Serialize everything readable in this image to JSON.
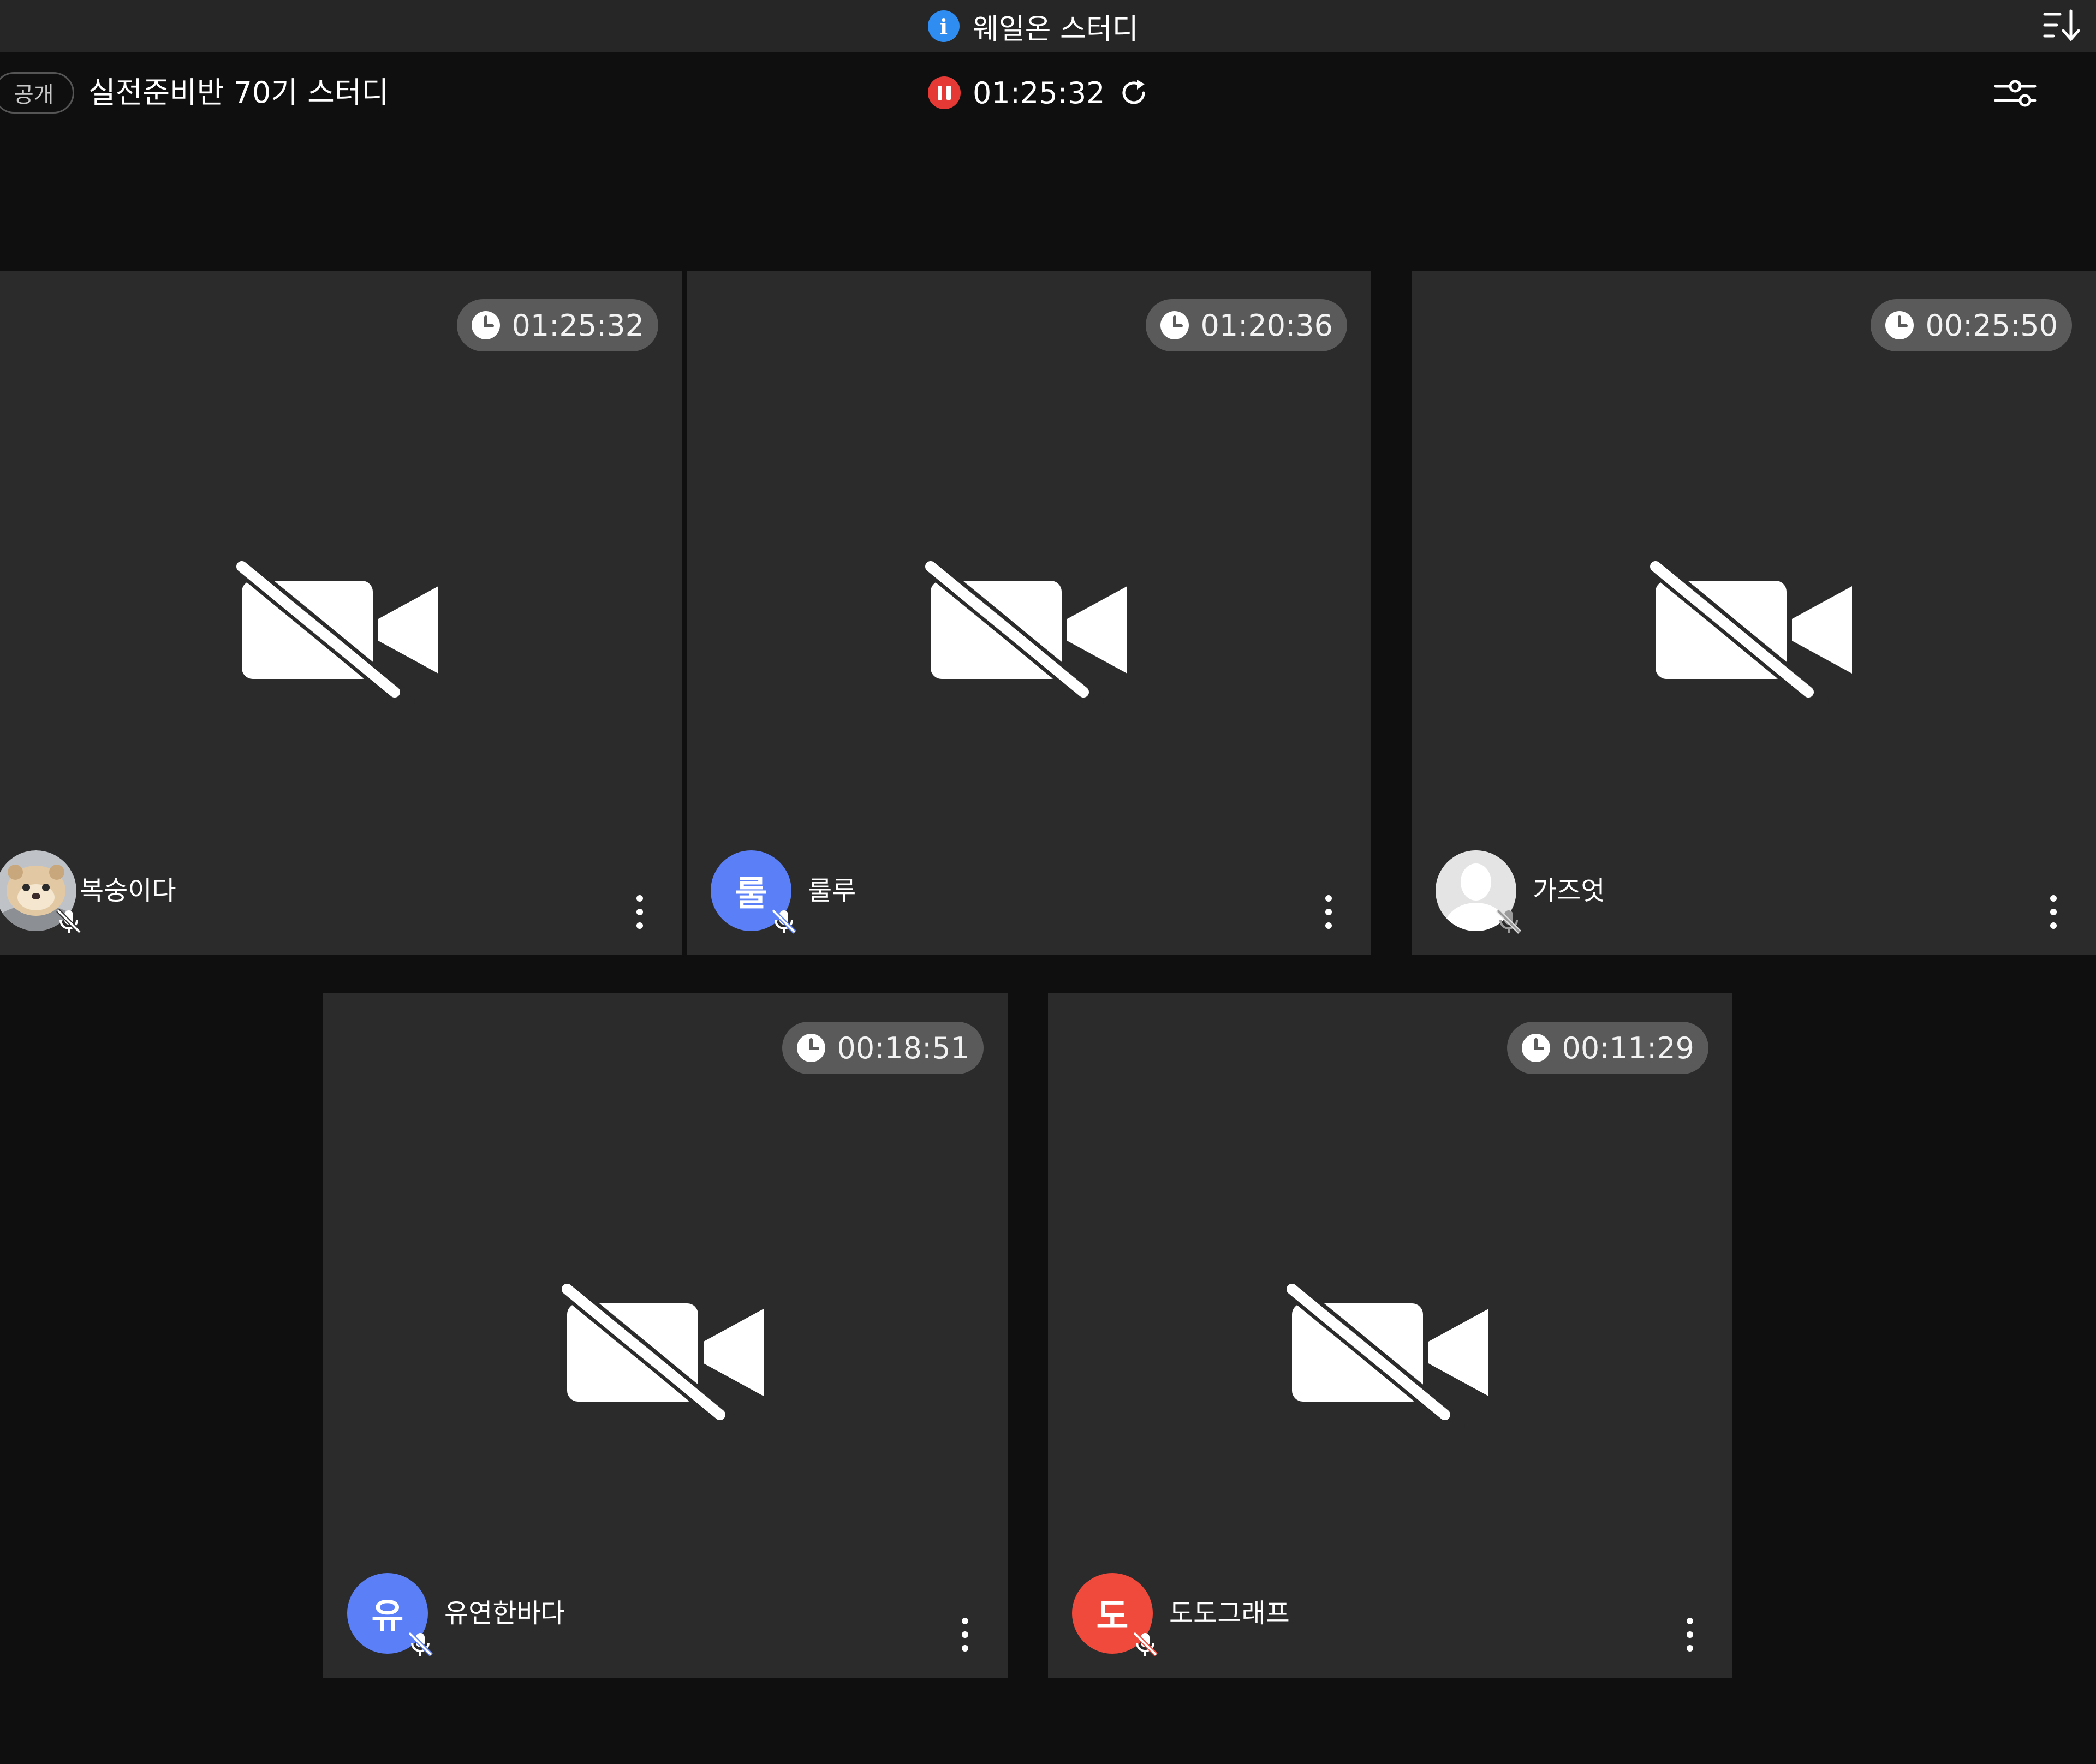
{
  "notice": {
    "text": "웨일온 스터디",
    "info_icon": "info-icon",
    "sort_icon": "sort-list-icon"
  },
  "room": {
    "badge": "공개",
    "title": "실전준비반 70기 스터디",
    "timer": "01:25:32",
    "timer_state": "paused",
    "pause_icon": "pause-icon",
    "reset_icon": "refresh-icon",
    "settings_icon": "settings-sliders-icon"
  },
  "colors": {
    "background": "#0f0f0f",
    "notice_bar": "#262626",
    "tile": "#2b2b2b",
    "time_badge": "#5a5a5a",
    "pause_red": "#e53935",
    "info_blue": "#2f8cf0",
    "avatar_blue": "#5b7ff7",
    "avatar_red": "#f04a3c",
    "avatar_default": "#e4e4e4"
  },
  "participants": [
    {
      "name": "복숭이다",
      "time": "01:25:32",
      "avatar_type": "photo",
      "avatar_text": "",
      "avatar_color": "",
      "camera": "off",
      "mic": "muted"
    },
    {
      "name": "룰루",
      "time": "01:20:36",
      "avatar_type": "initial",
      "avatar_text": "룰",
      "avatar_color": "#5b7ff7",
      "camera": "off",
      "mic": "muted"
    },
    {
      "name": "가즈엇",
      "time": "00:25:50",
      "avatar_type": "default",
      "avatar_text": "",
      "avatar_color": "#e4e4e4",
      "camera": "off",
      "mic": "muted"
    },
    {
      "name": "유연한바다",
      "time": "00:18:51",
      "avatar_type": "initial",
      "avatar_text": "유",
      "avatar_color": "#5b7ff7",
      "camera": "off",
      "mic": "muted"
    },
    {
      "name": "도도그래프",
      "time": "00:11:29",
      "avatar_type": "initial",
      "avatar_text": "도",
      "avatar_color": "#f04a3c",
      "camera": "off",
      "mic": "muted"
    }
  ]
}
